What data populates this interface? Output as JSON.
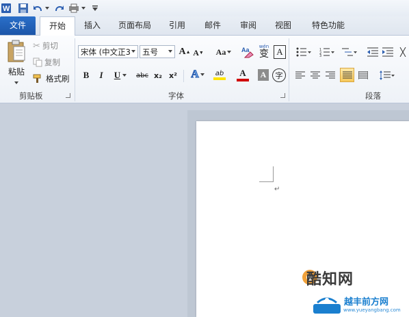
{
  "tabs": {
    "file": "文件",
    "home": "开始",
    "insert": "插入",
    "page_layout": "页面布局",
    "references": "引用",
    "mailings": "邮件",
    "review": "审阅",
    "view": "视图",
    "special": "特色功能"
  },
  "clipboard": {
    "paste": "粘贴",
    "cut": "剪切",
    "copy": "复制",
    "format_painter": "格式刷",
    "group_label": "剪贴板"
  },
  "font": {
    "font_name": "宋体 (中文正3",
    "font_size": "五号",
    "group_label": "字体",
    "grow": "A",
    "shrink": "A",
    "case": "Aa",
    "bold": "B",
    "italic": "I",
    "underline": "U",
    "strike": "abc",
    "subscript": "x₂",
    "superscript": "x²",
    "phonetic": "wén",
    "phonetic_char": "变",
    "border_char": "A",
    "effects": "A",
    "highlight": "ab",
    "font_color": "A",
    "char_shading": "A",
    "enclose": "字"
  },
  "paragraph": {
    "group_label": "段落"
  },
  "watermark": {
    "brand": "酷知网",
    "brand2": "越丰前方网",
    "url": "www.yueyangbang.com"
  },
  "colors": {
    "file_tab": "#1c56a8",
    "highlight": "#ffe400",
    "font_color": "#d00000"
  }
}
